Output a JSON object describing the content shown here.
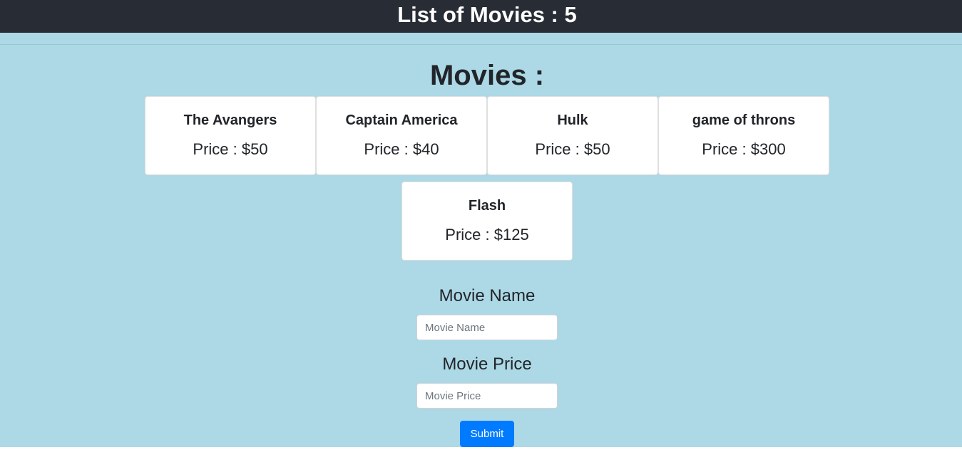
{
  "header": {
    "title": "List of Movies : 5"
  },
  "main": {
    "section_title": "Movies :",
    "movies": [
      {
        "name": "The Avangers",
        "price": "Price : $50"
      },
      {
        "name": "Captain America",
        "price": "Price : $40"
      },
      {
        "name": "Hulk",
        "price": "Price : $50"
      },
      {
        "name": "game of throns",
        "price": "Price : $300"
      },
      {
        "name": "Flash",
        "price": "Price : $125"
      }
    ]
  },
  "form": {
    "name_label": "Movie Name",
    "name_placeholder": "Movie Name",
    "name_value": "",
    "price_label": "Movie Price",
    "price_placeholder": "Movie Price",
    "price_value": "",
    "submit_label": "Submit"
  },
  "colors": {
    "header_bg": "#282c34",
    "main_bg": "#add8e6",
    "button_bg": "#007bff"
  }
}
